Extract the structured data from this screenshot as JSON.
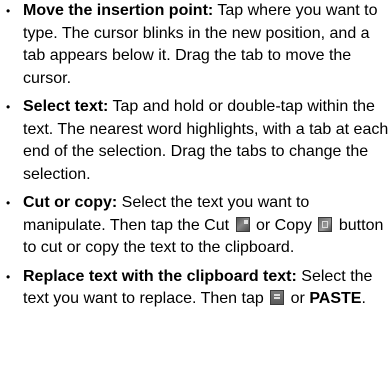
{
  "items": [
    {
      "bullet": "•",
      "term": "Move the insertion point:",
      "text": " Tap where you want to type. The cursor blinks in the new position, and a tab appears below it. Drag the tab to move the cursor."
    },
    {
      "bullet": "•",
      "term": "Select text:",
      "text": " Tap and hold or double-tap within the text. The nearest word highlights, with a tab at each end of the selection. Drag the tabs to change the selection."
    },
    {
      "bullet": "•",
      "term": "Cut or copy:",
      "text_a": " Select the text you want to manipulate. Then tap the Cut ",
      "text_b": " or Copy ",
      "text_c": " button to cut or copy the text to the clipboard.",
      "icons": [
        "cut-icon",
        "copy-icon"
      ]
    },
    {
      "bullet": "•",
      "term": "Replace text with the clipboard text:",
      "text_a": " Select the text you want to replace. Then tap ",
      "text_b": " or ",
      "term2": "PASTE",
      "text_c": ".",
      "icons": [
        "paste-icon"
      ]
    }
  ]
}
